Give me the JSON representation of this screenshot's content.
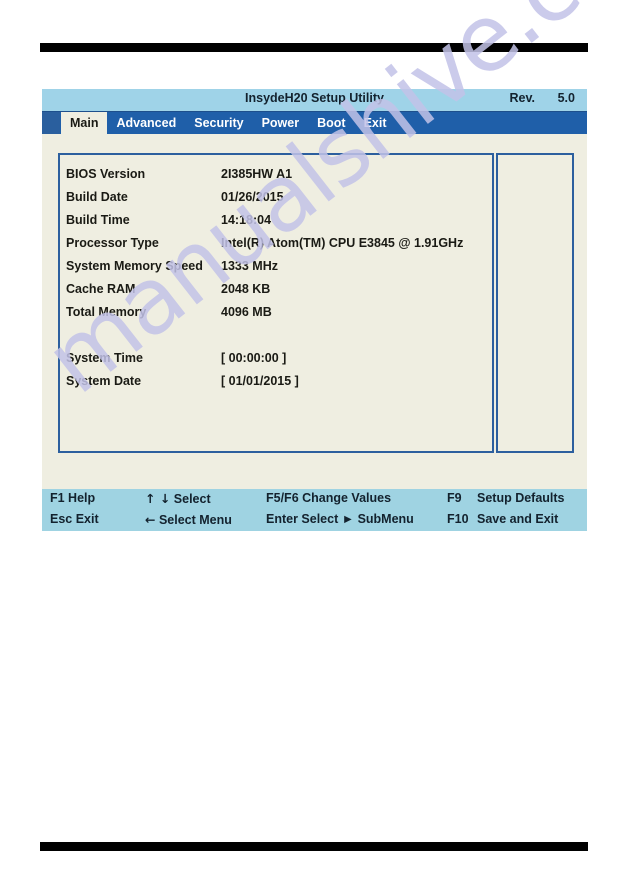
{
  "watermark": {
    "text": "manualshive.com"
  },
  "bios": {
    "titlebar": {
      "title": "InsydeH20 Setup Utility",
      "rev_label": "Rev.",
      "rev_value": "5.0"
    },
    "tabs": [
      {
        "label": "Main",
        "active": true
      },
      {
        "label": "Advanced",
        "active": false
      },
      {
        "label": "Security",
        "active": false
      },
      {
        "label": "Power",
        "active": false
      },
      {
        "label": "Boot",
        "active": false
      },
      {
        "label": "Exit",
        "active": false
      }
    ],
    "info_rows": [
      {
        "label": "BIOS Version",
        "value": "2I385HW A1"
      },
      {
        "label": "Build Date",
        "value": "01/26/2015"
      },
      {
        "label": "Build Time",
        "value": "14:18:04"
      },
      {
        "label": "Processor Type",
        "value": "Intel(R) Atom(TM) CPU E3845 @ 1.91GHz"
      },
      {
        "label": "System Memory Speed",
        "value": "1333 MHz"
      },
      {
        "label": "Cache RAM",
        "value": "2048 KB"
      },
      {
        "label": "Total Memory",
        "value": "4096 MB"
      }
    ],
    "time_rows": [
      {
        "label": "System Time",
        "value": "[ 00:00:00 ]"
      },
      {
        "label": "System Date",
        "value": "[ 01/01/2015 ]"
      }
    ],
    "footer": {
      "row1": {
        "help": "F1 Help",
        "select_keys": "↑ ↓",
        "select_label": "Select",
        "change_values": "F5/F6 Change Values",
        "defaults_key": "F9",
        "defaults_label": "Setup Defaults"
      },
      "row2": {
        "exit": "Esc Exit",
        "select_menu_key": "←",
        "select_menu_label": "Select Menu",
        "submenu": "Enter Select ► SubMenu",
        "save_key": "F10",
        "save_label": "Save and Exit"
      }
    }
  },
  "colors": {
    "titlebar_bg": "#9fd3e8",
    "tabbar_bg": "#1f5fa9",
    "panel_bg": "#efeee1",
    "panel_border": "#2c5f9e",
    "footer_bg": "#9fd3e2",
    "watermark": "#c3c3e8",
    "rule": "#000000"
  }
}
